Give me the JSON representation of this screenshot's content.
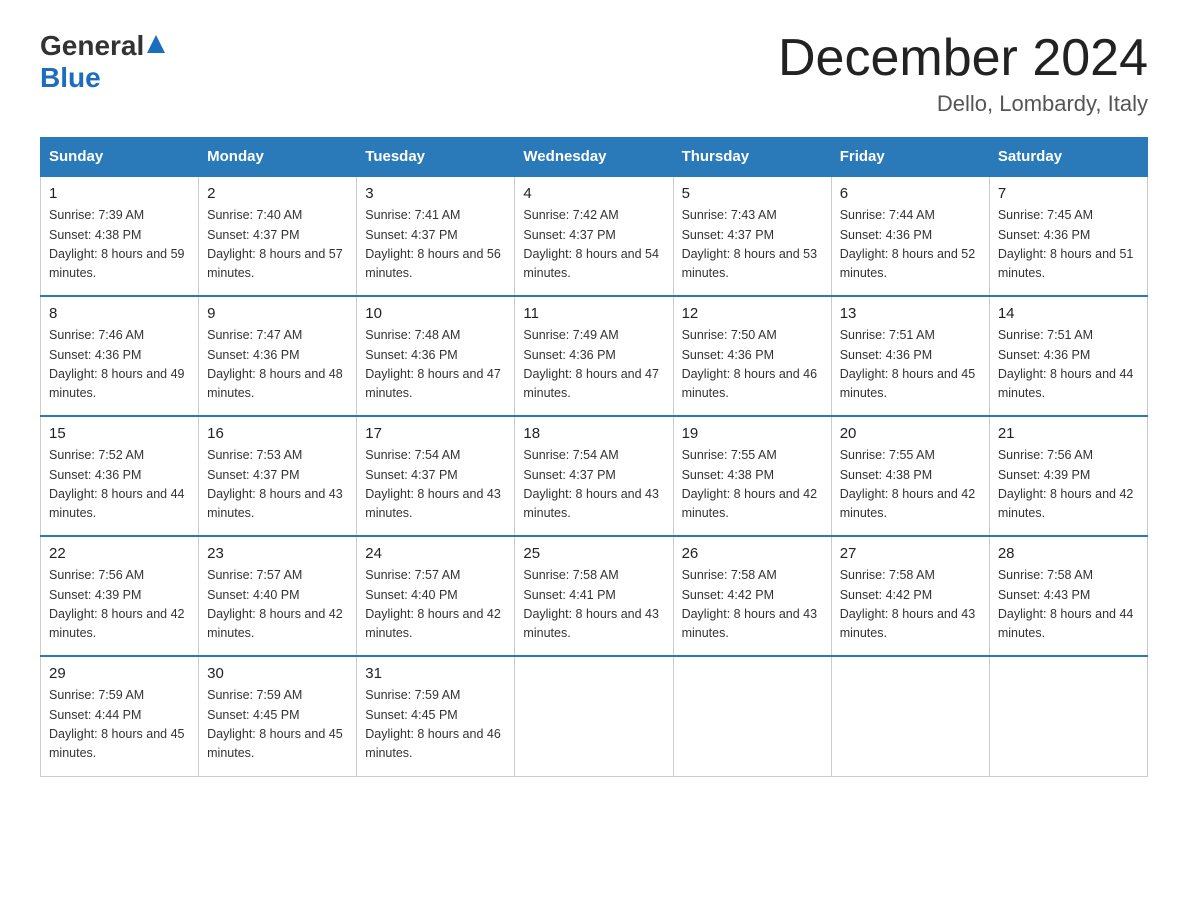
{
  "logo": {
    "general": "General",
    "blue": "Blue"
  },
  "header": {
    "month": "December 2024",
    "location": "Dello, Lombardy, Italy"
  },
  "days_of_week": [
    "Sunday",
    "Monday",
    "Tuesday",
    "Wednesday",
    "Thursday",
    "Friday",
    "Saturday"
  ],
  "weeks": [
    [
      {
        "day": "1",
        "sunrise": "7:39 AM",
        "sunset": "4:38 PM",
        "daylight": "8 hours and 59 minutes."
      },
      {
        "day": "2",
        "sunrise": "7:40 AM",
        "sunset": "4:37 PM",
        "daylight": "8 hours and 57 minutes."
      },
      {
        "day": "3",
        "sunrise": "7:41 AM",
        "sunset": "4:37 PM",
        "daylight": "8 hours and 56 minutes."
      },
      {
        "day": "4",
        "sunrise": "7:42 AM",
        "sunset": "4:37 PM",
        "daylight": "8 hours and 54 minutes."
      },
      {
        "day": "5",
        "sunrise": "7:43 AM",
        "sunset": "4:37 PM",
        "daylight": "8 hours and 53 minutes."
      },
      {
        "day": "6",
        "sunrise": "7:44 AM",
        "sunset": "4:36 PM",
        "daylight": "8 hours and 52 minutes."
      },
      {
        "day": "7",
        "sunrise": "7:45 AM",
        "sunset": "4:36 PM",
        "daylight": "8 hours and 51 minutes."
      }
    ],
    [
      {
        "day": "8",
        "sunrise": "7:46 AM",
        "sunset": "4:36 PM",
        "daylight": "8 hours and 49 minutes."
      },
      {
        "day": "9",
        "sunrise": "7:47 AM",
        "sunset": "4:36 PM",
        "daylight": "8 hours and 48 minutes."
      },
      {
        "day": "10",
        "sunrise": "7:48 AM",
        "sunset": "4:36 PM",
        "daylight": "8 hours and 47 minutes."
      },
      {
        "day": "11",
        "sunrise": "7:49 AM",
        "sunset": "4:36 PM",
        "daylight": "8 hours and 47 minutes."
      },
      {
        "day": "12",
        "sunrise": "7:50 AM",
        "sunset": "4:36 PM",
        "daylight": "8 hours and 46 minutes."
      },
      {
        "day": "13",
        "sunrise": "7:51 AM",
        "sunset": "4:36 PM",
        "daylight": "8 hours and 45 minutes."
      },
      {
        "day": "14",
        "sunrise": "7:51 AM",
        "sunset": "4:36 PM",
        "daylight": "8 hours and 44 minutes."
      }
    ],
    [
      {
        "day": "15",
        "sunrise": "7:52 AM",
        "sunset": "4:36 PM",
        "daylight": "8 hours and 44 minutes."
      },
      {
        "day": "16",
        "sunrise": "7:53 AM",
        "sunset": "4:37 PM",
        "daylight": "8 hours and 43 minutes."
      },
      {
        "day": "17",
        "sunrise": "7:54 AM",
        "sunset": "4:37 PM",
        "daylight": "8 hours and 43 minutes."
      },
      {
        "day": "18",
        "sunrise": "7:54 AM",
        "sunset": "4:37 PM",
        "daylight": "8 hours and 43 minutes."
      },
      {
        "day": "19",
        "sunrise": "7:55 AM",
        "sunset": "4:38 PM",
        "daylight": "8 hours and 42 minutes."
      },
      {
        "day": "20",
        "sunrise": "7:55 AM",
        "sunset": "4:38 PM",
        "daylight": "8 hours and 42 minutes."
      },
      {
        "day": "21",
        "sunrise": "7:56 AM",
        "sunset": "4:39 PM",
        "daylight": "8 hours and 42 minutes."
      }
    ],
    [
      {
        "day": "22",
        "sunrise": "7:56 AM",
        "sunset": "4:39 PM",
        "daylight": "8 hours and 42 minutes."
      },
      {
        "day": "23",
        "sunrise": "7:57 AM",
        "sunset": "4:40 PM",
        "daylight": "8 hours and 42 minutes."
      },
      {
        "day": "24",
        "sunrise": "7:57 AM",
        "sunset": "4:40 PM",
        "daylight": "8 hours and 42 minutes."
      },
      {
        "day": "25",
        "sunrise": "7:58 AM",
        "sunset": "4:41 PM",
        "daylight": "8 hours and 43 minutes."
      },
      {
        "day": "26",
        "sunrise": "7:58 AM",
        "sunset": "4:42 PM",
        "daylight": "8 hours and 43 minutes."
      },
      {
        "day": "27",
        "sunrise": "7:58 AM",
        "sunset": "4:42 PM",
        "daylight": "8 hours and 43 minutes."
      },
      {
        "day": "28",
        "sunrise": "7:58 AM",
        "sunset": "4:43 PM",
        "daylight": "8 hours and 44 minutes."
      }
    ],
    [
      {
        "day": "29",
        "sunrise": "7:59 AM",
        "sunset": "4:44 PM",
        "daylight": "8 hours and 45 minutes."
      },
      {
        "day": "30",
        "sunrise": "7:59 AM",
        "sunset": "4:45 PM",
        "daylight": "8 hours and 45 minutes."
      },
      {
        "day": "31",
        "sunrise": "7:59 AM",
        "sunset": "4:45 PM",
        "daylight": "8 hours and 46 minutes."
      },
      null,
      null,
      null,
      null
    ]
  ],
  "labels": {
    "sunrise": "Sunrise:",
    "sunset": "Sunset:",
    "daylight": "Daylight:"
  }
}
